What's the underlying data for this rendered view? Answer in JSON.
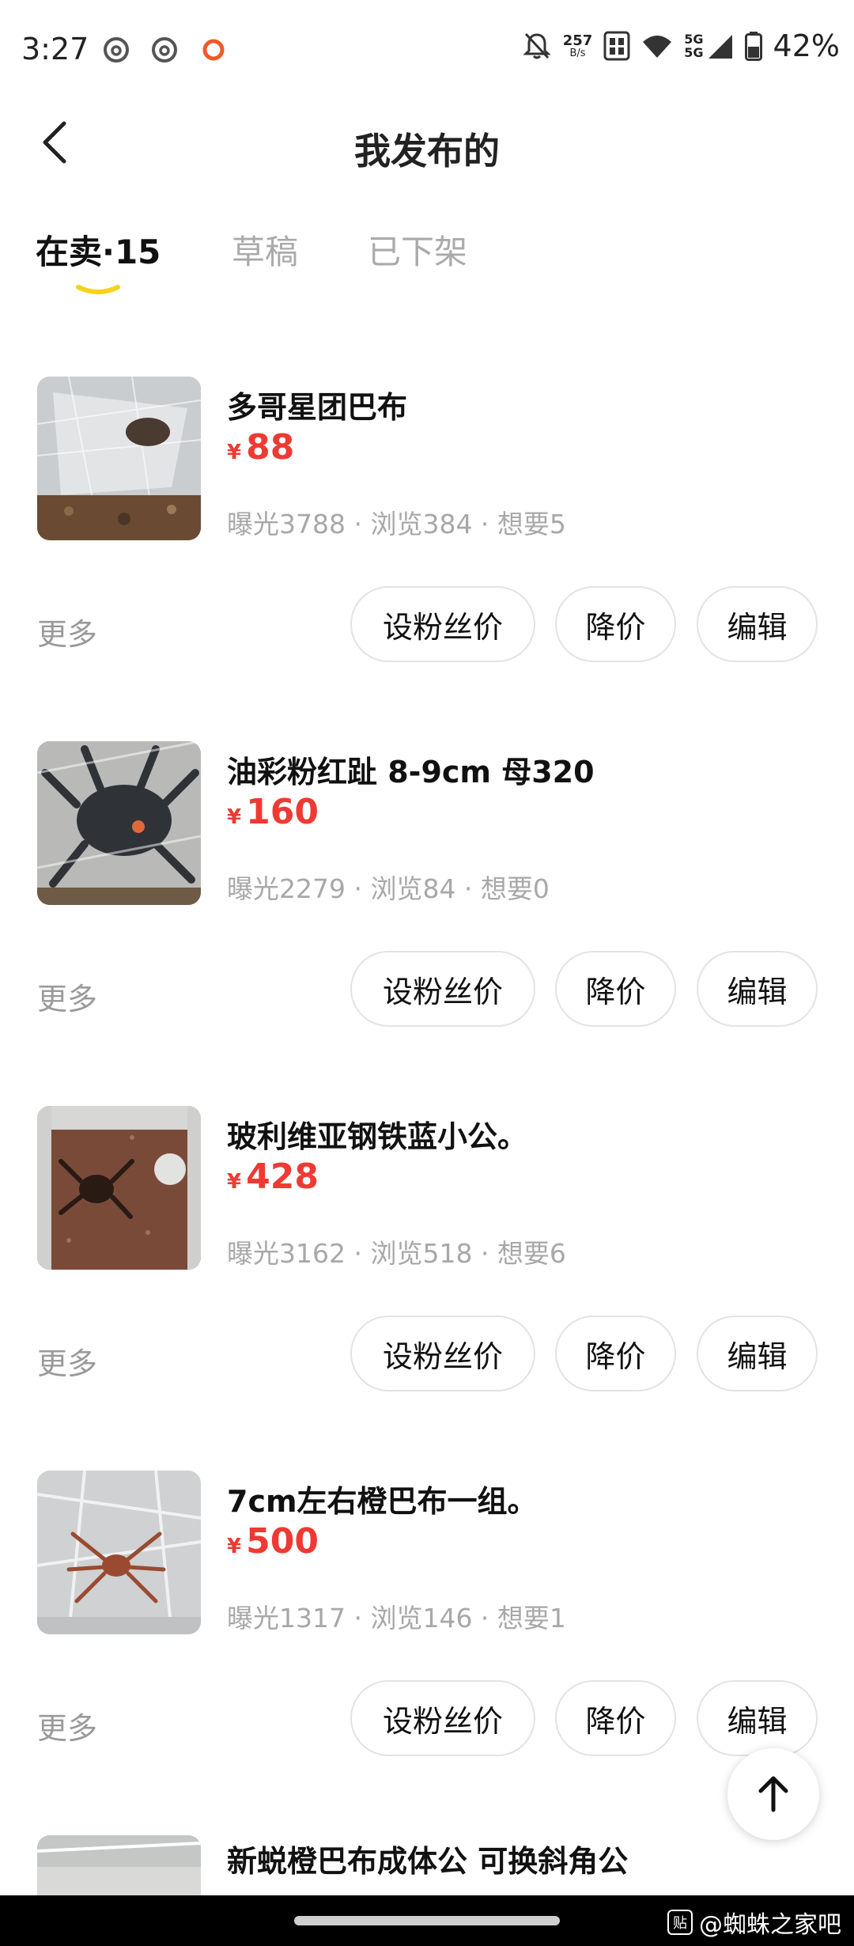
{
  "status_bar": {
    "time": "3:27",
    "net_speed": "257",
    "net_unit": "B/s",
    "signal_label_top": "5G",
    "signal_label_bottom": "5G",
    "battery": "42%"
  },
  "header": {
    "title": "我发布的",
    "back_icon": "chevron-left-icon"
  },
  "tabs": [
    {
      "label": "在卖·15",
      "active": true
    },
    {
      "label": "草稿",
      "active": false
    },
    {
      "label": "已下架",
      "active": false
    }
  ],
  "colors": {
    "price": "#ee3a33",
    "tab_underline": "#f7d21c",
    "muted": "#a8a8a8"
  },
  "items": [
    {
      "title": "多哥星团巴布",
      "currency": "¥",
      "price": "88",
      "stats": "曝光3788 · 浏览384 · 想要5"
    },
    {
      "title": "油彩粉红趾 8-9cm 母320",
      "currency": "¥",
      "price": "160",
      "stats": "曝光2279 · 浏览84 · 想要0"
    },
    {
      "title": "玻利维亚钢铁蓝小公。",
      "currency": "¥",
      "price": "428",
      "stats": "曝光3162 · 浏览518 · 想要6"
    },
    {
      "title": "7cm左右橙巴布一组。",
      "currency": "¥",
      "price": "500",
      "stats": "曝光1317 · 浏览146 · 想要1"
    },
    {
      "title": "新蜕橙巴布成体公 可换斜角公"
    }
  ],
  "item_actions": {
    "more": "更多",
    "fan_price": "设粉丝价",
    "reduce_price": "降价",
    "edit": "编辑"
  },
  "watermark": {
    "logo": "贴",
    "text": "@蜘蛛之家吧"
  }
}
